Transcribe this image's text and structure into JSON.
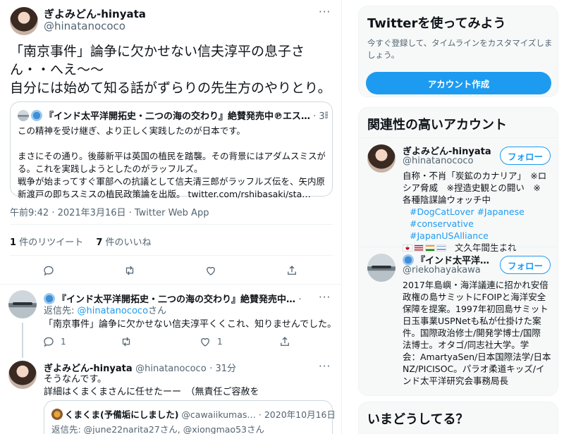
{
  "tweet": {
    "author_name": "ぎよみどん-hinyata",
    "author_handle": "@hinatanococo",
    "more_label": "···",
    "text_lines": [
      "「南京事件」論争に欠かせない信夫淳平の息子さ",
      "ん・・へえ〜〜",
      "自分には始めて知る話がずらりの先生方のやりとり。"
    ],
    "quoted": {
      "author": "『インド太平洋開拓史・二つの海の交わり』絶賛発売中℗エス…",
      "time": "· 3時間",
      "lines": [
        "この精神を受け継ぎ、より正しく実践したのが日本です。",
        "",
        "まさにその通り。後藤新平は英国の植民を踏襲。その背景にはアダムスミスがい",
        "る。これを実践しようとしたのがラッフルズ。",
        "戦争が始まってすぐ軍部への抗議として信夫清三郎がラッフルズ伝を、矢内原が",
        "新渡戸の即ちスミスの植民政策論を出版。 twitter.com/rshibasaki/sta…"
      ]
    },
    "meta": "午前9:42 · 2021年3月16日 · Twitter Web App",
    "retweets_count": "1",
    "retweets_label": "件のリツイート",
    "likes_count": "7",
    "likes_label": "件のいいね"
  },
  "replies": [
    {
      "author_name": "『インド太平洋開拓史・二つの海の交わり』絶賛発売中…",
      "time": "· 35分",
      "reply_to_prefix": "返信先: ",
      "reply_to_handle": "@hinatanococo",
      "reply_to_suffix": "さん",
      "text": "「南京事件」論争に欠かせない信夫淳平くくこれ、知りませんでした。",
      "reply_count": "1",
      "like_count": "1"
    },
    {
      "author_name": "ぎよみどん-hinyata",
      "author_handle": "@hinatanococo",
      "time": "· 31分",
      "text_lines": [
        "そうなんです。",
        "詳細はくまくまさんに任せたーー　（無責任ご容赦を"
      ],
      "quoted": {
        "author": "くまくま(予備垢にしました)",
        "handle": "@cawaiikumas…",
        "time": "· 2020年10月16日",
        "reply_to": "返信先: @june22narita27さん, @xiongmao53さん"
      }
    }
  ],
  "sidebar": {
    "signup": {
      "title": "Twitterを使ってみよう",
      "desc_lines": [
        "今すぐ登録して、タイムラインをカスタマイズしま",
        "しょう。"
      ],
      "button": "アカウント作成"
    },
    "relevant": {
      "title": "関連性の高いアカウント",
      "follow_label": "フォロー",
      "accounts": [
        {
          "name": "ぎよみどん-hinyata",
          "handle": "@hinatanococo",
          "bio_lines": [
            "自称・不肖「炭鉱のカナリア」　※ロ",
            "シア脅威　※捏造史観との闘い　※",
            "各種陰謀論ウォッチ中",
            "#DogCatLover #Japanese",
            "#conservative #JapanUSAlliance",
            "文久年間生まれ"
          ]
        },
        {
          "name": "『インド太平洋…",
          "handle": "@riekohayakawa",
          "bio_lines": [
            "2017年島嶼・海洋議連に招かれ安倍",
            "政権の島サミットにFOIPと海洋安全",
            "保障を提案。1997年初回島サミット",
            "日玉事業USPNetも私が仕掛けた案",
            "件。国際政治修士/開発学博士/国際",
            "法博士。オタゴ/同志社大学。学",
            "会：AmartyaSen/日本国際法学/日本",
            "NZ/PICISOC。パラオ柔道キッズ/イ",
            "ンド太平洋研究会事務局長"
          ]
        }
      ]
    },
    "trends": {
      "title": "いまどうしてる？"
    }
  },
  "colors": {
    "accent": "#1d9bf0",
    "text": "#0f1419",
    "muted": "#536471",
    "border": "#cfd9de"
  }
}
